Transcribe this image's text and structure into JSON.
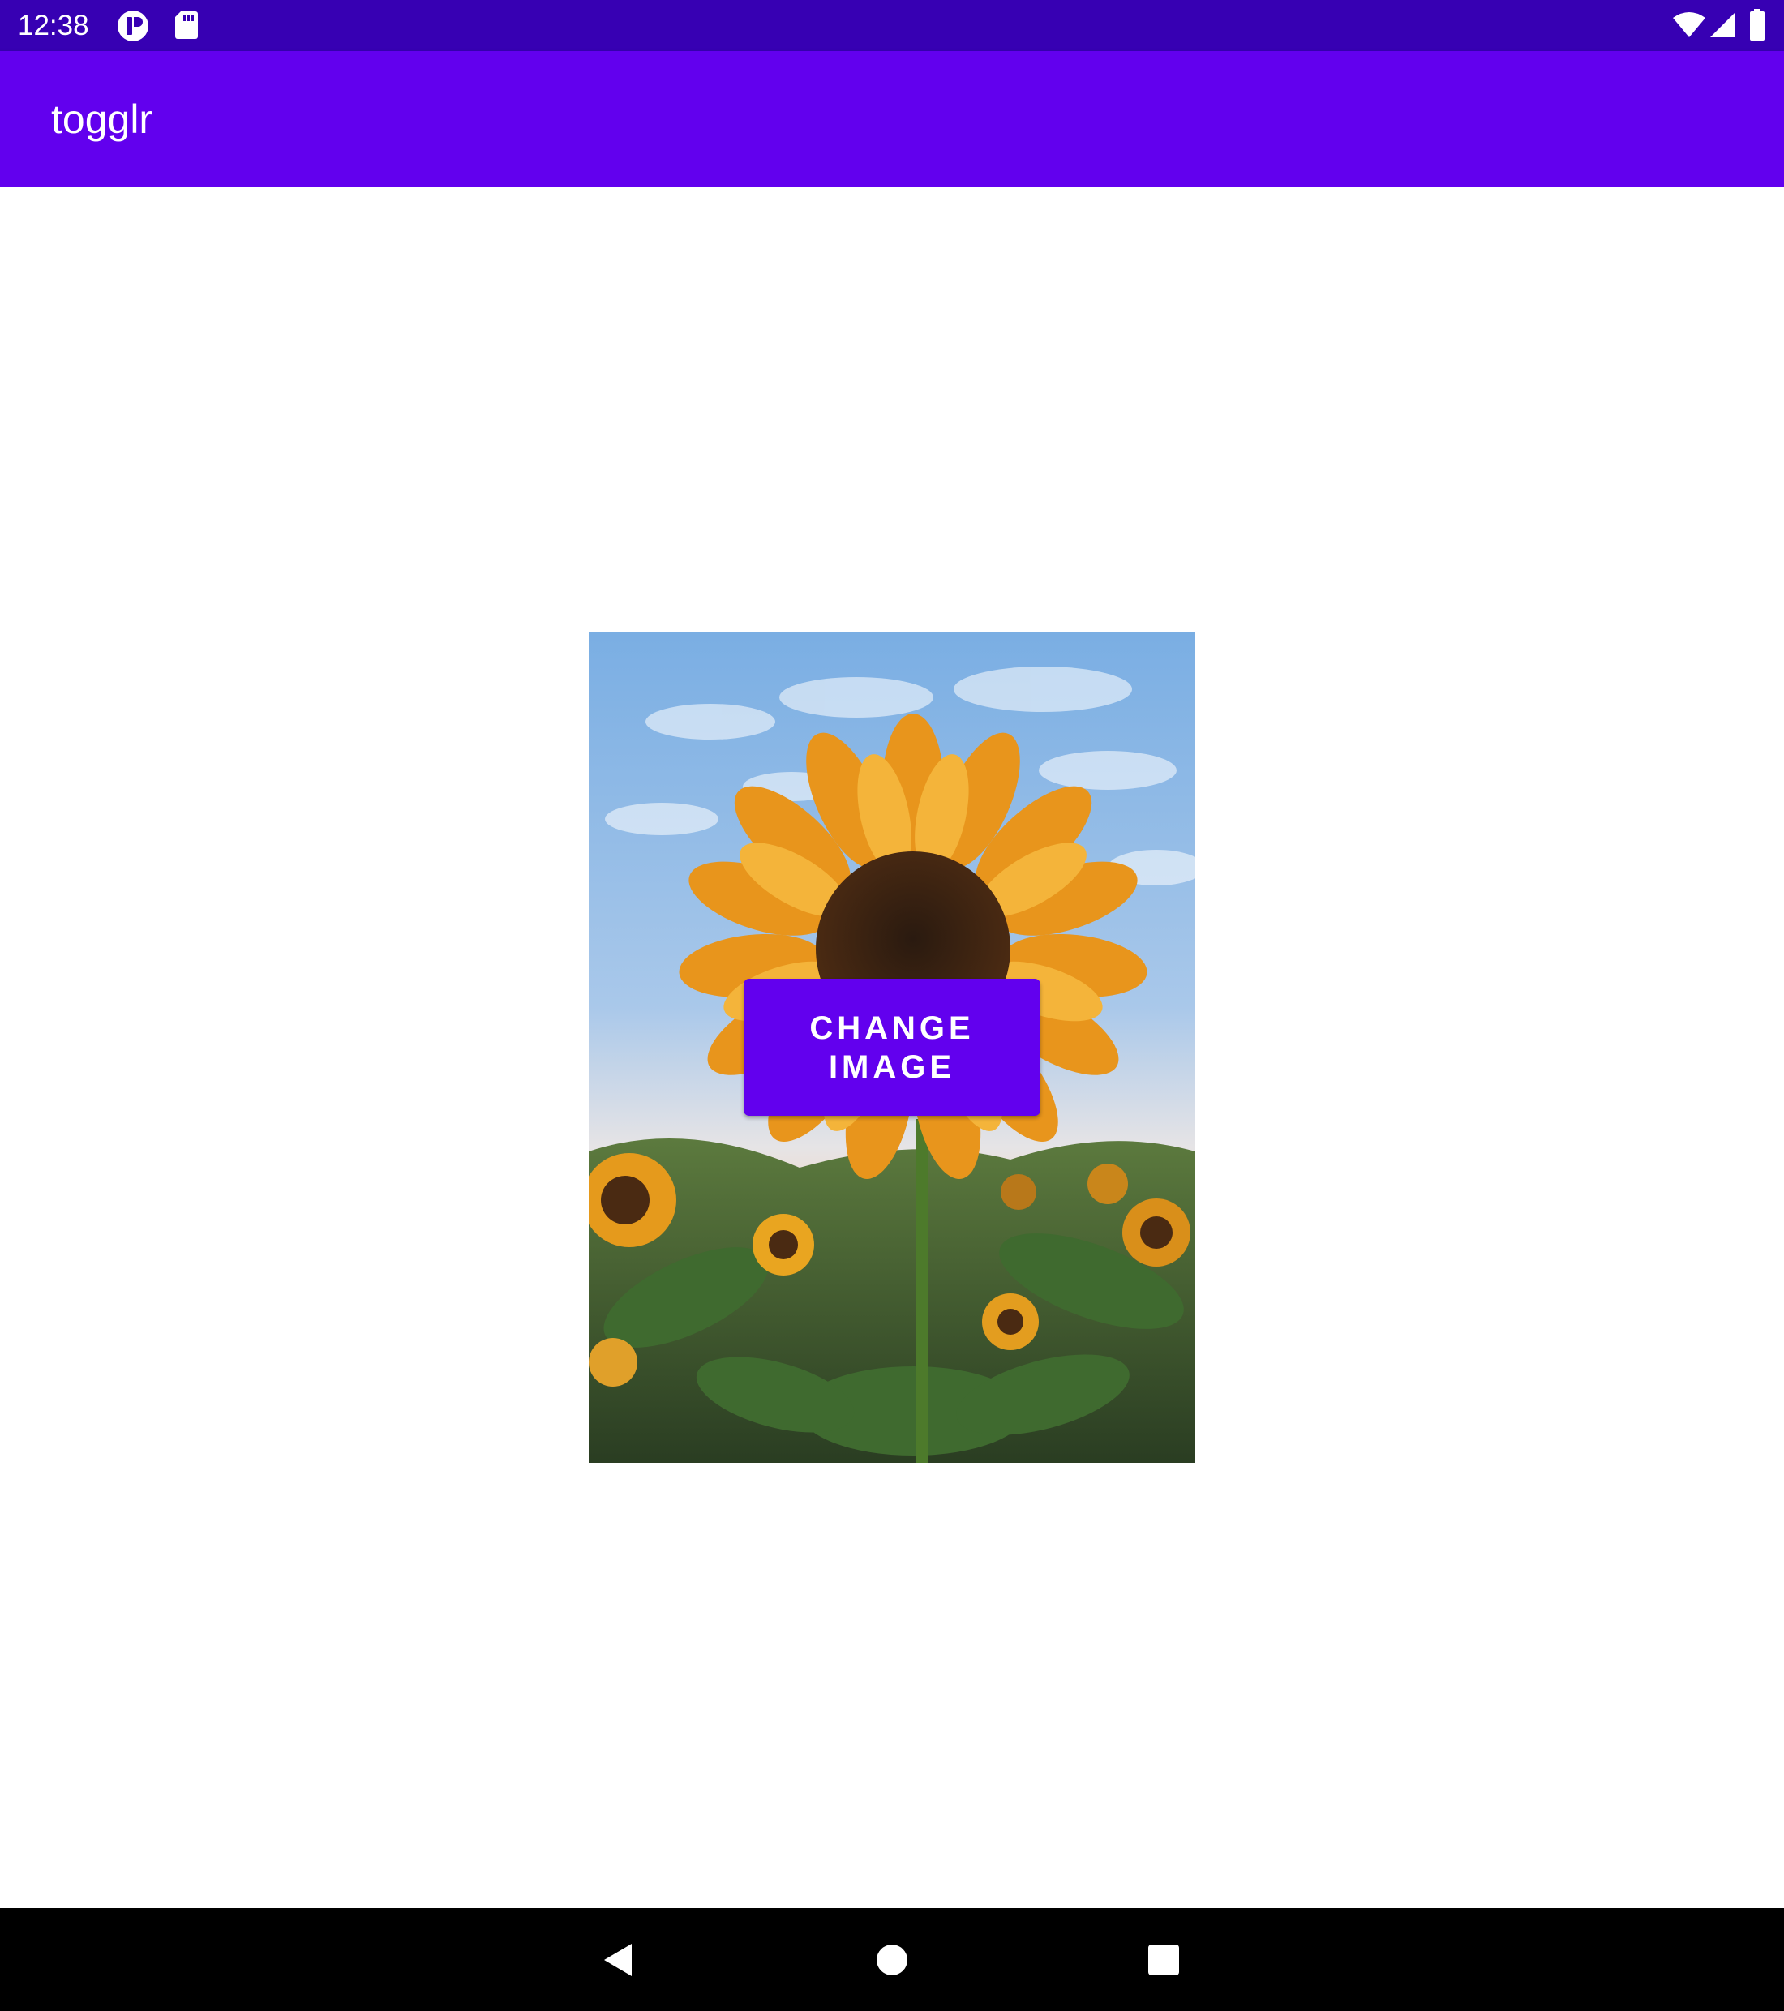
{
  "status_bar": {
    "time": "12:38",
    "icons": [
      "app-notification-icon",
      "sd-card-icon",
      "wifi-icon",
      "signal-icon",
      "battery-icon"
    ]
  },
  "app_bar": {
    "title": "togglr"
  },
  "main": {
    "image": {
      "subject": "sunflower-field-photo"
    },
    "change_button_label": "CHANGE IMAGE"
  },
  "nav_bar": {
    "buttons": [
      "back-icon",
      "home-icon",
      "recents-icon"
    ]
  },
  "colors": {
    "status_bar": "#3700b3",
    "primary": "#6200ee",
    "background": "#ffffff",
    "nav_bar": "#000000"
  }
}
